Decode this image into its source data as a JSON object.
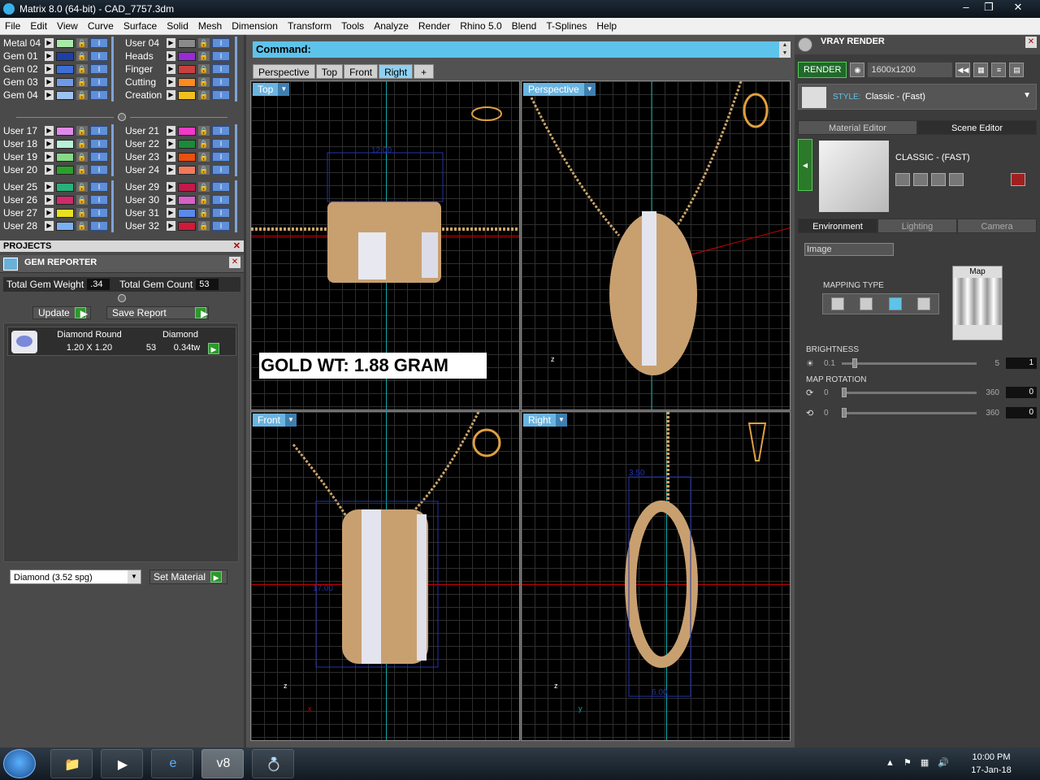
{
  "window": {
    "title": "Matrix 8.0 (64-bit) - CAD_7757.3dm",
    "min": "–",
    "restore": "❐",
    "close": "✕"
  },
  "menu": [
    "File",
    "Edit",
    "View",
    "Curve",
    "Surface",
    "Solid",
    "Mesh",
    "Dimension",
    "Transform",
    "Tools",
    "Analyze",
    "Render",
    "Rhino 5.0",
    "Blend",
    "T-Splines",
    "Help"
  ],
  "layers": {
    "group1_left": [
      {
        "name": "Metal 04",
        "color": "#a8e8a8"
      },
      {
        "name": "Gem 01",
        "color": "#1f3fa8"
      },
      {
        "name": "Gem 02",
        "color": "#3e6ed8"
      },
      {
        "name": "Gem 03",
        "color": "#6f9ae8"
      },
      {
        "name": "Gem 04",
        "color": "#9dc2f0"
      }
    ],
    "group1_right": [
      {
        "name": "User 04",
        "color": "#8a8a8a"
      },
      {
        "name": "Heads",
        "color": "#9a2ad8"
      },
      {
        "name": "Finger",
        "color": "#c84040"
      },
      {
        "name": "Cutting",
        "color": "#ff8a20"
      },
      {
        "name": "Creation",
        "color": "#f0c020"
      }
    ],
    "group2_left": [
      {
        "name": "User 17",
        "color": "#e08ae8"
      },
      {
        "name": "User 18",
        "color": "#b8f0d8"
      },
      {
        "name": "User 19",
        "color": "#88d888"
      },
      {
        "name": "User 20",
        "color": "#2aa02a"
      }
    ],
    "group2_right": [
      {
        "name": "User 21",
        "color": "#f03ac8"
      },
      {
        "name": "User 22",
        "color": "#1a8a3a"
      },
      {
        "name": "User 23",
        "color": "#e85010"
      },
      {
        "name": "User 24",
        "color": "#f07a5a"
      }
    ],
    "group3_left": [
      {
        "name": "User 25",
        "color": "#2ab07a"
      },
      {
        "name": "User 26",
        "color": "#d02a6a"
      },
      {
        "name": "User 27",
        "color": "#e8e020"
      },
      {
        "name": "User 28",
        "color": "#7ab0f0"
      }
    ],
    "group3_right": [
      {
        "name": "User 29",
        "color": "#c01a4a"
      },
      {
        "name": "User 30",
        "color": "#d860c8"
      },
      {
        "name": "User 31",
        "color": "#5a8ae8"
      },
      {
        "name": "User 32",
        "color": "#d01a3a"
      }
    ]
  },
  "projects": {
    "title": "PROJECTS",
    "close": "✕"
  },
  "gem_reporter": {
    "title": "GEM REPORTER",
    "close": "✕",
    "weight_label": "Total Gem Weight",
    "weight_value": ".34",
    "count_label": "Total Gem Count",
    "count_value": "53",
    "update_label": "Update",
    "save_report_label": "Save Report",
    "item": {
      "shape": "Diamond Round",
      "size": "1.20 X 1.20",
      "type": "Diamond",
      "count": "53",
      "tw": "0.34tw"
    },
    "material_select": "Diamond    (3.52 spg)",
    "set_material_label": "Set Material"
  },
  "command": {
    "label": "Command:"
  },
  "viewport_tabs": [
    "Perspective",
    "Top",
    "Front",
    "Right"
  ],
  "viewport_add": "+",
  "viewports": {
    "top": {
      "label": "Top",
      "dim": "12.00"
    },
    "perspective": {
      "label": "Perspective"
    },
    "front": {
      "label": "Front",
      "dim": "17.00"
    },
    "right": {
      "label": "Right",
      "dim_top": "3.50",
      "dim_bottom": "6.00"
    }
  },
  "gold_weight": "GOLD WT: 1.88 GRAM",
  "vray": {
    "title": "VRAY RENDER",
    "close": "✕",
    "render_label": "RENDER",
    "resolution": "1600x1200",
    "style_label": "STYLE:",
    "style_value": "Classic - (Fast)",
    "tabs": [
      "Material Editor",
      "Scene Editor"
    ],
    "scene_name": "CLASSIC - (FAST)",
    "env_tabs": [
      "Environment",
      "Lighting",
      "Camera"
    ],
    "image_select": "Image",
    "mapping_type": "MAPPING TYPE",
    "map_label": "Map",
    "brightness": {
      "label": "BRIGHTNESS",
      "min": "0.1",
      "max": "5",
      "value": "1",
      "level": 0.08
    },
    "map_rotation": {
      "label": "MAP ROTATION",
      "min": "0",
      "max": "360",
      "value1": "0",
      "value2": "0"
    }
  },
  "taskbar": {
    "clock_time": "10:00 PM",
    "clock_date": "17-Jan-18",
    "matrix_label": "v8"
  }
}
